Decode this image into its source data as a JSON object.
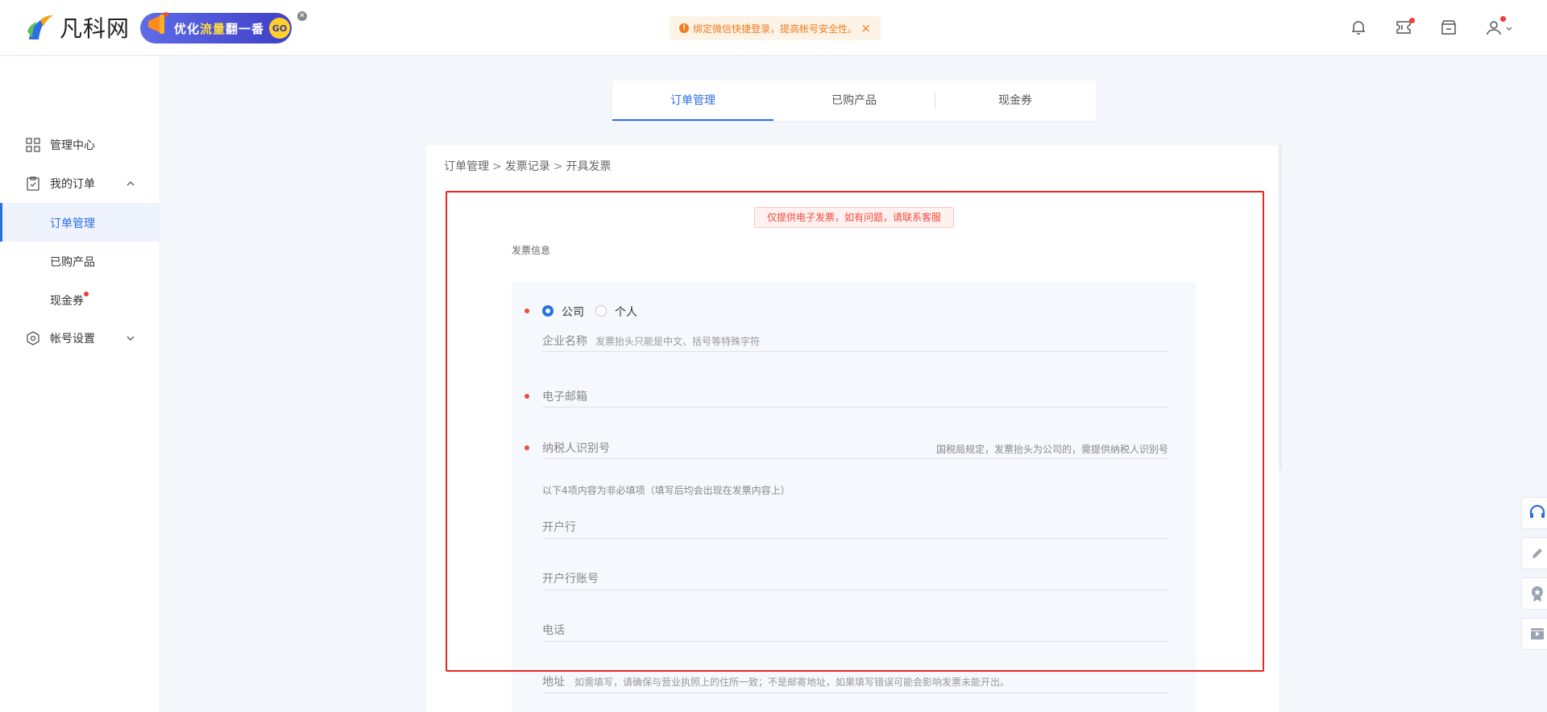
{
  "header": {
    "logo_text": "凡科网",
    "promo": {
      "text_part1": "优化",
      "text_highlight": "流量",
      "text_part2": "翻一番",
      "go": "GO"
    },
    "notice_text": "绑定微信快捷登录，提高帐号安全性。"
  },
  "sidebar": {
    "items": [
      {
        "label": "管理中心"
      },
      {
        "label": "我的订单"
      },
      {
        "label": "订单管理"
      },
      {
        "label": "已购产品"
      },
      {
        "label": "现金券"
      },
      {
        "label": "帐号设置"
      }
    ]
  },
  "tabs": [
    {
      "label": "订单管理"
    },
    {
      "label": "已购产品"
    },
    {
      "label": "现金券"
    }
  ],
  "breadcrumb": [
    "订单管理",
    "发票记录",
    "开具发票"
  ],
  "breadcrumb_sep": ">",
  "alert_text": "仅提供电子发票，如有问题，请联系客服",
  "section_title": "发票信息",
  "form": {
    "radio_company": "公司",
    "radio_person": "个人",
    "company_label": "企业名称",
    "company_placeholder": "发票抬头只能是中文、括号等特殊字符",
    "email_label": "电子邮箱",
    "taxid_label": "纳税人识别号",
    "taxid_hint": "国税局规定，发票抬头为公司的，需提供纳税人识别号",
    "optional_note": "以下4项内容为非必填项（填写后均会出现在发票内容上）",
    "bank_label": "开户行",
    "account_label": "开户行账号",
    "phone_label": "电话",
    "address_label": "地址",
    "address_placeholder": "如需填写，请确保与营业执照上的住所一致；不是邮寄地址，如果填写错误可能会影响发票未能开出。"
  },
  "colors": {
    "accent": "#2b6de5",
    "alert_red": "#f04a3d",
    "notice_orange": "#f07b1d",
    "annotation_red": "#e8281e"
  }
}
